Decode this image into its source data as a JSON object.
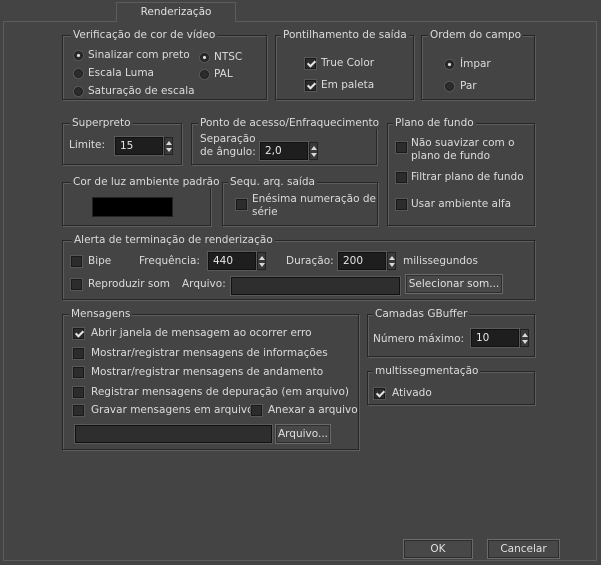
{
  "tab": {
    "label": "Renderização"
  },
  "video_color_check": {
    "title": "Verificação de cor de vídeo",
    "options": [
      "Sinalizar com preto",
      "Escala Luma",
      "Saturação de escala"
    ],
    "standards": [
      "NTSC",
      "PAL"
    ]
  },
  "output_dithering": {
    "title": "Pontilhamento de saída",
    "true_color": "True Color",
    "paletted": "Em paleta"
  },
  "field_order": {
    "title": "Ordem do campo",
    "odd": "Ímpar",
    "even": "Par"
  },
  "super_black": {
    "title": "Superpreto",
    "threshold_label": "Limite:",
    "threshold_value": "15"
  },
  "hotspot_falloff": {
    "title": "Ponto de acesso/Enfraquecimento",
    "angle_label_line1": "Separação",
    "angle_label_line2": "de ângulo:",
    "angle_value": "2,0"
  },
  "background": {
    "title": "Plano de fundo",
    "dont_antialias_line1": "Não suavizar com o",
    "dont_antialias_line2": "plano de fundo",
    "filter": "Filtrar plano de fundo",
    "env_alpha": "Usar ambiente alfa"
  },
  "ambient": {
    "title": "Cor de luz ambiente padrão",
    "color": "#000000"
  },
  "output_file_seq": {
    "title": "Sequ. arq. saída",
    "nth_line1": "Enésima numeração de",
    "nth_line2": "série"
  },
  "render_alert": {
    "title": "Alerta de terminação de renderização",
    "beep": "Bipe",
    "frequency_label": "Frequência:",
    "frequency_value": "440",
    "duration_label": "Duração:",
    "duration_value": "200",
    "ms_label": "milissegundos",
    "play_sound": "Reproduzir som",
    "file_label": "Arquivo:",
    "file_value": "",
    "choose_sound": "Selecionar som..."
  },
  "messages": {
    "title": "Mensagens",
    "open_on_error": "Abrir janela de mensagem ao ocorrer erro",
    "info": "Mostrar/registrar mensagens de informações",
    "progress": "Mostrar/registrar mensagens de andamento",
    "debug": "Registrar mensagens de depuração (em arquivo)",
    "to_file": "Gravar mensagens em arquivo",
    "append": "Anexar a arquivo",
    "file_value": "",
    "file_button": "Arquivo..."
  },
  "gbuffer": {
    "title": "Camadas GBuffer",
    "max_label": "Número máximo:",
    "max_value": "10"
  },
  "multiseg": {
    "title": "multissegmentação",
    "enabled": "Ativado"
  },
  "footer": {
    "ok": "OK",
    "cancel": "Cancelar"
  }
}
